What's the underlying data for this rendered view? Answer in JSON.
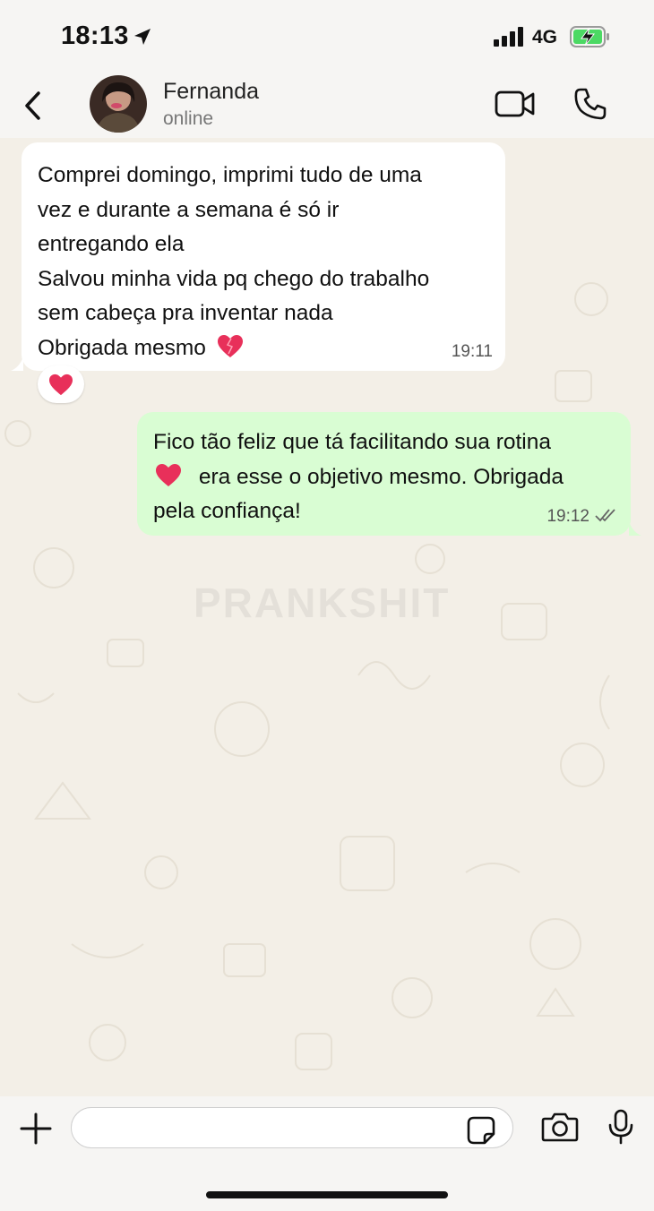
{
  "status_bar": {
    "time": "18:13",
    "network": "4G",
    "icons": [
      "location-arrow-icon",
      "signal-bars-icon",
      "battery-charging-icon"
    ]
  },
  "header": {
    "contact_name": "Fernanda",
    "contact_status": "online",
    "icons": [
      "back-chevron-icon",
      "video-call-icon",
      "phone-call-icon"
    ]
  },
  "watermark": "PRANKSHIT",
  "messages": [
    {
      "direction": "incoming",
      "lines": [
        "Comprei domingo, imprimi tudo de uma",
        "vez e durante a semana é só ir",
        "entregando ela",
        "Salvou minha vida pq chego do trabalho",
        "sem cabeça pra inventar nada",
        "Obrigada mesmo"
      ],
      "emoji": "heart-icon",
      "time": "19:11",
      "reaction": "heart-icon"
    },
    {
      "direction": "outgoing",
      "text_part1": "Fico tão feliz que tá facilitando sua rotina",
      "text_part2": "era esse o objetivo mesmo. Obrigada",
      "text_part3": "pela confiança!",
      "emoji": "heart-icon",
      "time": "19:12",
      "status": "read-ticks-icon"
    }
  ],
  "input_bar": {
    "placeholder": "",
    "icons": [
      "plus-icon",
      "sticker-icon",
      "camera-icon",
      "microphone-icon"
    ]
  },
  "colors": {
    "chat_background": "#f3efe7",
    "incoming_bubble": "#ffffff",
    "outgoing_bubble": "#d9fdd3",
    "heart": "#e8305a"
  }
}
